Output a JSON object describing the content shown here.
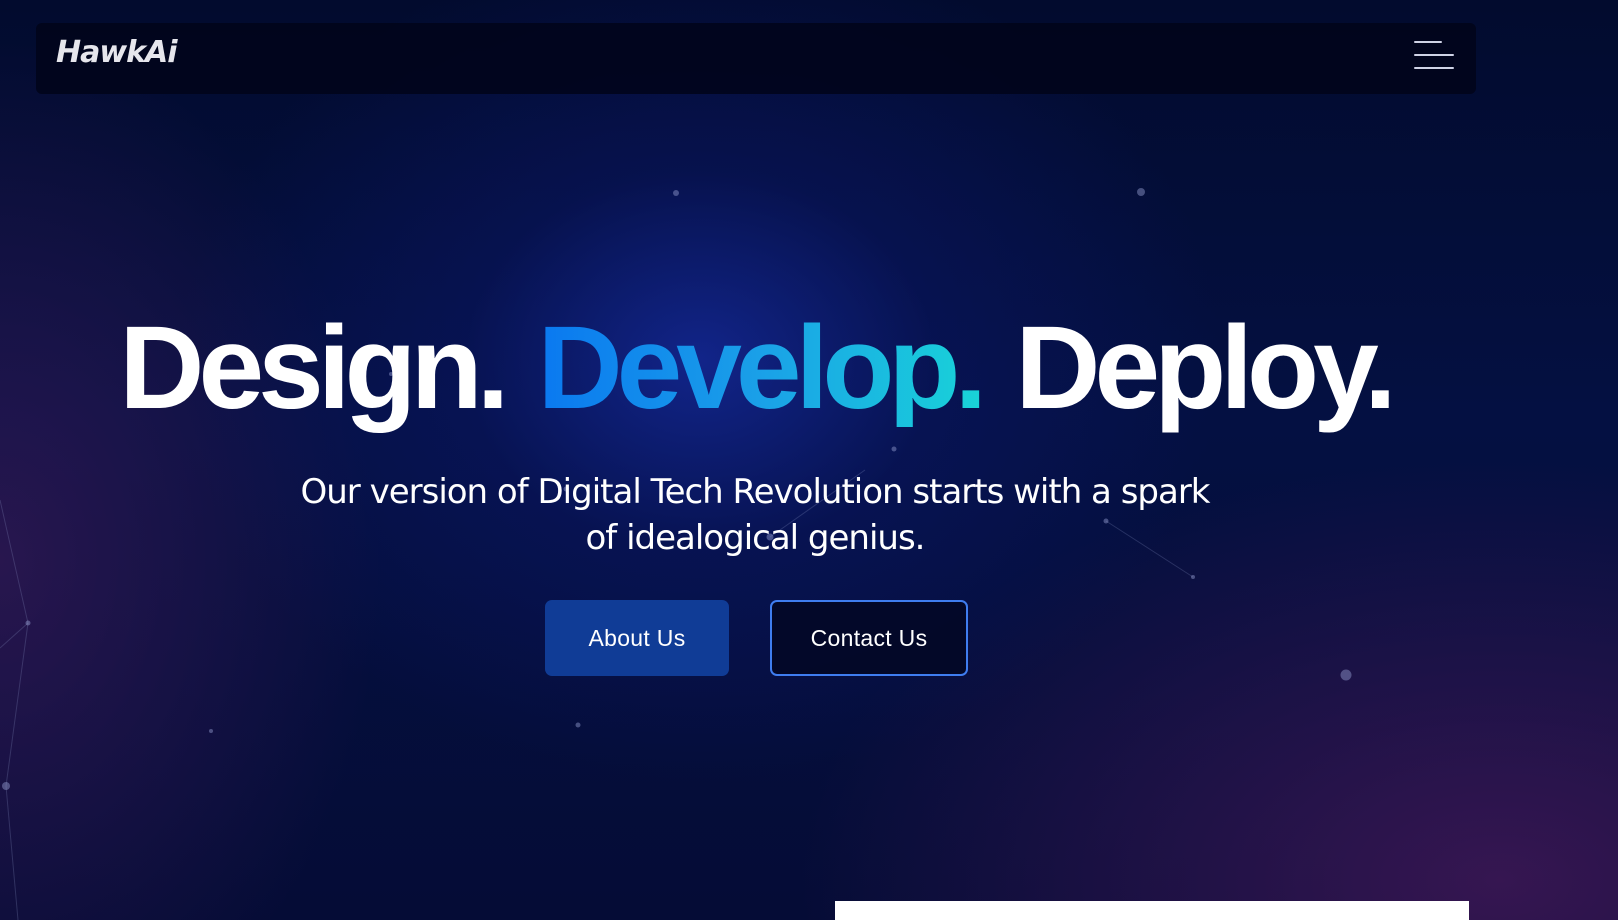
{
  "brand": {
    "logo_text": "HawkAi"
  },
  "nav": {
    "menu_icon": "hamburger-menu-icon"
  },
  "hero": {
    "headline": {
      "word1": "Design.",
      "word2": "Develop.",
      "word3": "Deploy."
    },
    "subtitle": "Our version of Digital Tech Revolution starts with a spark of idealogical genius.",
    "about_button": "About Us",
    "contact_button": "Contact Us"
  },
  "colors": {
    "background": "#041042",
    "accent_gradient_start": "#0a78f0",
    "accent_gradient_end": "#19d3d8",
    "primary_button": "#103c96",
    "outline_button_border": "#3f7df0"
  }
}
